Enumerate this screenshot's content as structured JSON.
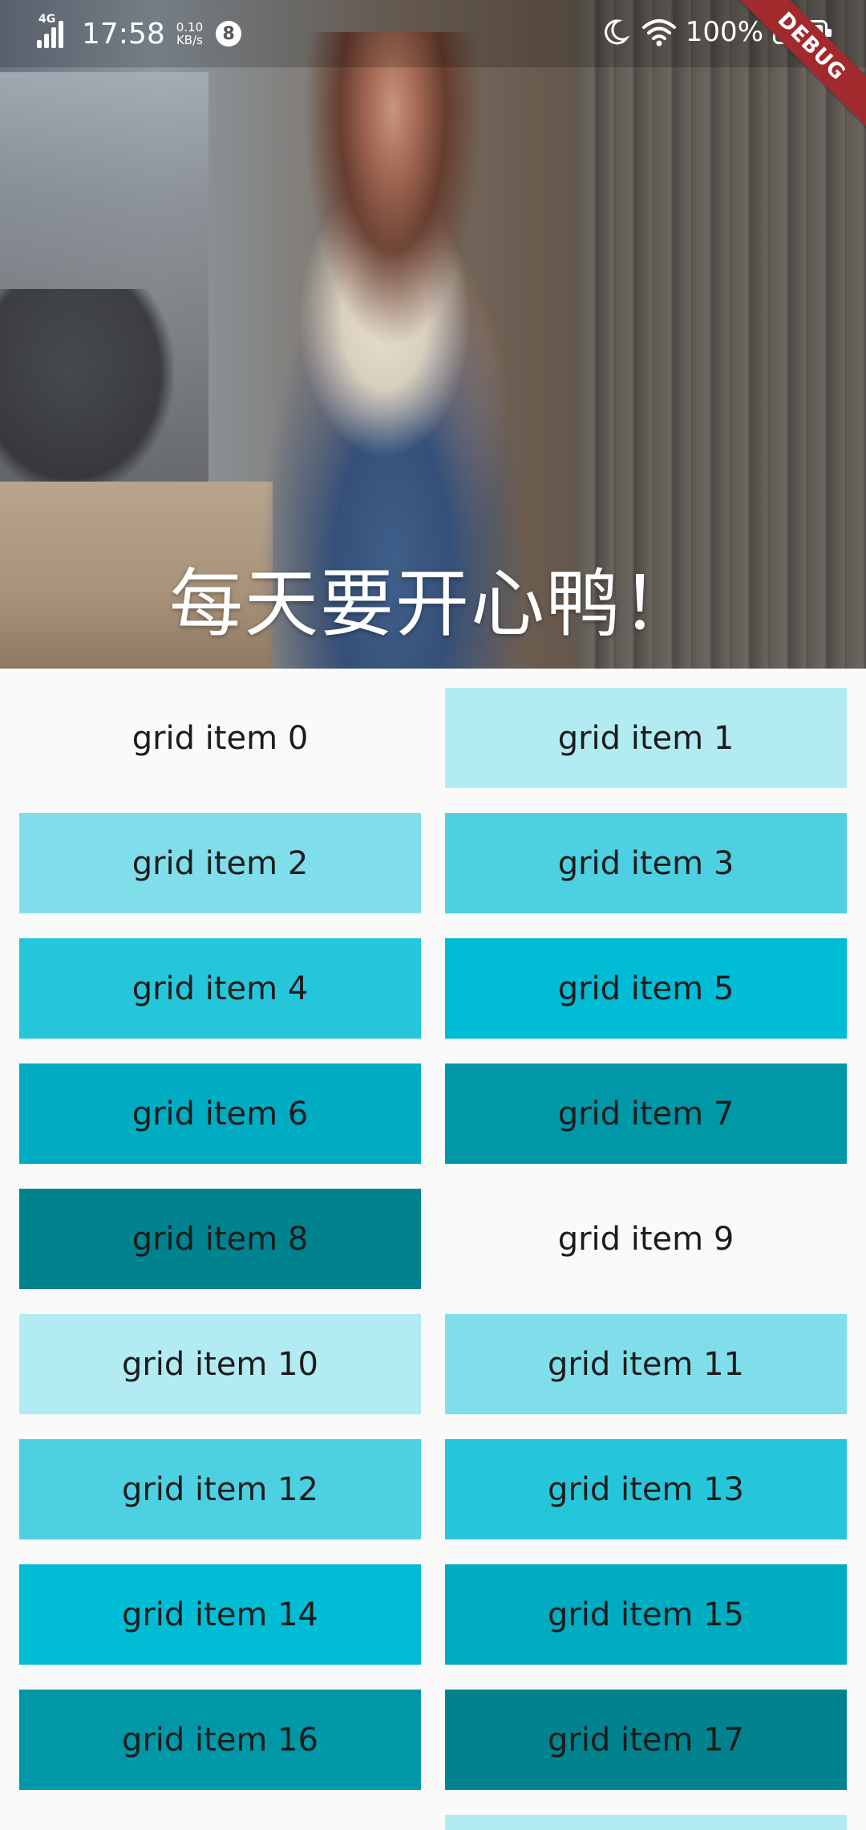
{
  "status_bar": {
    "network": "4G",
    "time": "17:58",
    "speed_value": "0.10",
    "speed_unit": "KB/s",
    "notification_count": "8",
    "battery_percent": "100%"
  },
  "debug_label": "DEBUG",
  "hero": {
    "title": "每天要开心鸭！"
  },
  "grid": {
    "items": [
      {
        "label": "grid item 0",
        "color": "#fafafa"
      },
      {
        "label": "grid item 1",
        "color": "#b2ebf2"
      },
      {
        "label": "grid item 2",
        "color": "#80deea"
      },
      {
        "label": "grid item 3",
        "color": "#4dd0e1"
      },
      {
        "label": "grid item 4",
        "color": "#26c6da"
      },
      {
        "label": "grid item 5",
        "color": "#00bcd4"
      },
      {
        "label": "grid item 6",
        "color": "#00acc1"
      },
      {
        "label": "grid item 7",
        "color": "#0097a7"
      },
      {
        "label": "grid item 8",
        "color": "#00838f"
      },
      {
        "label": "grid item 9",
        "color": "#fafafa"
      },
      {
        "label": "grid item 10",
        "color": "#b2ebf2"
      },
      {
        "label": "grid item 11",
        "color": "#80deea"
      },
      {
        "label": "grid item 12",
        "color": "#4dd0e1"
      },
      {
        "label": "grid item 13",
        "color": "#26c6da"
      },
      {
        "label": "grid item 14",
        "color": "#00bcd4"
      },
      {
        "label": "grid item 15",
        "color": "#00acc1"
      },
      {
        "label": "grid item 16",
        "color": "#0097a7"
      },
      {
        "label": "grid item 17",
        "color": "#00838f"
      },
      {
        "label": "",
        "color": "#fafafa"
      },
      {
        "label": "",
        "color": "#b2ebf2"
      }
    ]
  },
  "icons": {
    "signal": "signal-icon",
    "notification": "notification-badge-icon",
    "moon": "moon-icon",
    "wifi": "wifi-icon",
    "battery": "battery-icon"
  }
}
